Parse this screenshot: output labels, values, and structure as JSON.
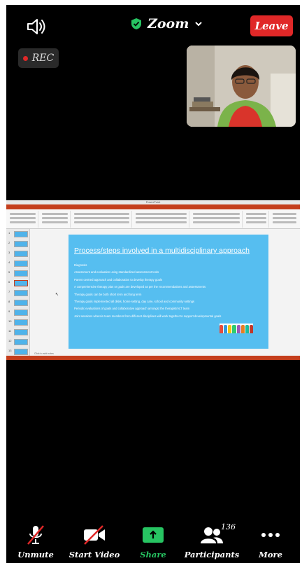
{
  "header": {
    "speaker_icon": "speaker-icon",
    "title": "Zoom",
    "title_chevron": "⌄",
    "leave_label": "Leave",
    "rec_label": "REC",
    "accent_leave": "#e02828",
    "secure_color": "#27c462"
  },
  "shared_screen": {
    "slide": {
      "title": "Process/steps involved in a multidisciplinary approach",
      "bullets": [
        "Diagnosis",
        "Assessment and evaluation using standardized assessment tools",
        "Parent centred approach and collaboration to develop therapy goals",
        "A comprehensive therapy plan or goals are developed as per the recommendations and assessments",
        "Therapy goals can be both short term and long term",
        "Therapy goals implemented all disks, home setting, day care, school and community settings",
        "Periodic evaluations of goals and collaborative approach amongst the therapist/ALT team",
        "Joint sessions wherein team members from different disciplines will work together to support developmental goals"
      ],
      "background": "#56bef0"
    },
    "notes_placeholder": "Click to add notes"
  },
  "toolbar": {
    "unmute_label": "Unmute",
    "start_video_label": "Start Video",
    "share_label": "Share",
    "participants_label": "Participants",
    "participants_count": "136",
    "more_label": "More",
    "share_color": "#27c462"
  }
}
